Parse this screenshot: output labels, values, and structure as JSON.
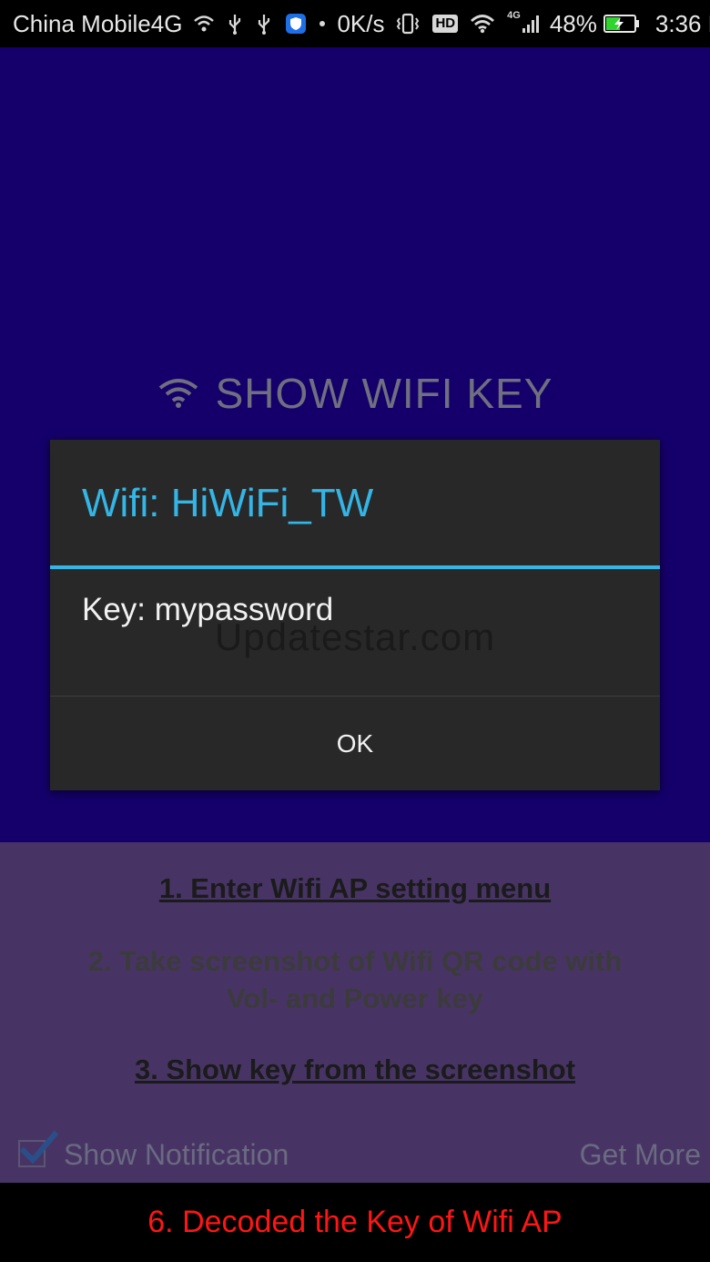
{
  "status_bar": {
    "carrier": "China Mobile4G",
    "speed": "0K/s",
    "hd": "HD",
    "network": "4G",
    "battery": "48%",
    "time": "3:36 PM"
  },
  "app": {
    "title": "SHOW WIFI KEY",
    "watermark": "Updatestar.com"
  },
  "dialog": {
    "title": "Wifi: HiWiFi_TW",
    "message": "Key: mypassword",
    "ok_label": "OK",
    "accent_color": "#33b5e5"
  },
  "steps": [
    {
      "label": "1. Enter Wifi AP setting menu"
    },
    {
      "label": "2. Take screenshot of Wifi QR code with Vol- and Power key"
    },
    {
      "label": "3. Show key from the screenshot"
    }
  ],
  "options": {
    "show_notification_label": "Show Notification",
    "show_notification_checked": true,
    "get_more_label": "Get More"
  },
  "banner": {
    "text": "6. Decoded the Key of Wifi AP",
    "color": "#ff1515"
  }
}
